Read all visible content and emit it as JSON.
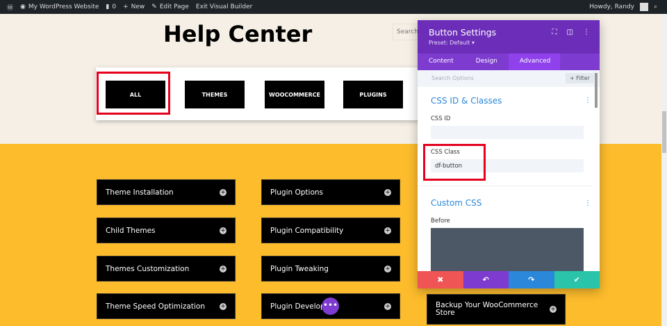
{
  "adminbar": {
    "site": "My WordPress Website",
    "comments": "0",
    "new": "New",
    "edit": "Edit Page",
    "exit": "Exit Visual Builder",
    "howdy": "Howdy, Randy"
  },
  "page": {
    "title": "Help Center",
    "search_placeholder": "Search"
  },
  "filters": [
    "ALL",
    "THEMES",
    "WOOCOMMERCE",
    "PLUGINS"
  ],
  "accordions": {
    "col1": [
      "Theme Installation",
      "Child Themes",
      "Themes Customization",
      "Theme Speed Optimization"
    ],
    "col2": [
      "Plugin Options",
      "Plugin Compatibility",
      "Plugin Tweaking",
      "Plugin Development"
    ],
    "col3": [
      "Backup Your WooCommerce Store"
    ]
  },
  "panel": {
    "title": "Button Settings",
    "preset": "Preset: Default ▾",
    "tabs": [
      "Content",
      "Design",
      "Advanced"
    ],
    "active_tab": "Advanced",
    "search_placeholder": "Search Options",
    "filter": "+ Filter",
    "section1": "CSS ID & Classes",
    "css_id_label": "CSS ID",
    "css_id_value": "",
    "css_class_label": "CSS Class",
    "css_class_value": "df-button",
    "section2": "Custom CSS",
    "before_label": "Before"
  },
  "colors": {
    "accent": "#6c2eb9",
    "cancel": "#ef5555",
    "undo": "#7e3bd0",
    "redo": "#2b87da",
    "save": "#29c4a9",
    "highlight": "#e5001c",
    "background": "#fdbc2c"
  }
}
